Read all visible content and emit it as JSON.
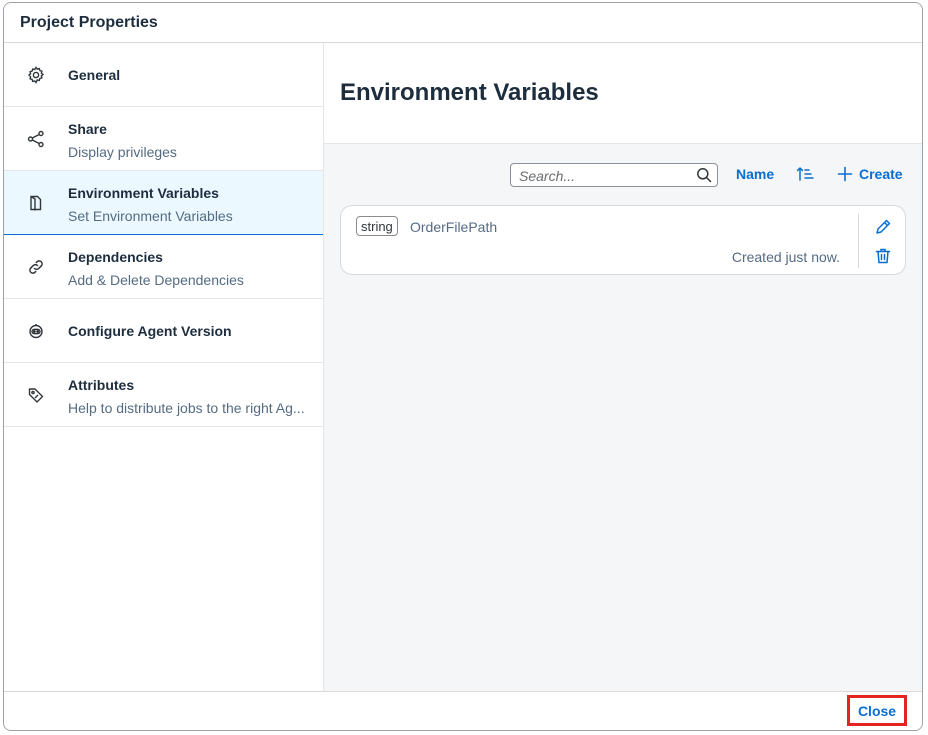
{
  "dialog": {
    "title": "Project Properties"
  },
  "sidebar": {
    "items": [
      {
        "label": "General",
        "subtitle": "",
        "icon": "gear-icon"
      },
      {
        "label": "Share",
        "subtitle": "Display privileges",
        "icon": "share-icon"
      },
      {
        "label": "Environment Variables",
        "subtitle": "Set Environment Variables",
        "icon": "document-icon",
        "selected": true
      },
      {
        "label": "Dependencies",
        "subtitle": "Add & Delete Dependencies",
        "icon": "link-icon"
      },
      {
        "label": "Configure Agent Version",
        "subtitle": "",
        "icon": "robot-icon"
      },
      {
        "label": "Attributes",
        "subtitle": "Help to distribute jobs to the right Ag...",
        "icon": "tag-icon"
      }
    ]
  },
  "content": {
    "title": "Environment Variables",
    "toolbar": {
      "search_placeholder": "Search...",
      "search_value": "",
      "name_label": "Name",
      "create_label": "Create"
    },
    "variables": [
      {
        "type": "string",
        "name": "OrderFilePath",
        "created": "Created just now."
      }
    ]
  },
  "footer": {
    "close_label": "Close"
  },
  "colors": {
    "accent": "#0a6ed1",
    "selected_bg": "#ebf8ff",
    "content_bg": "#f5f6f7",
    "highlight": "#e32420"
  }
}
